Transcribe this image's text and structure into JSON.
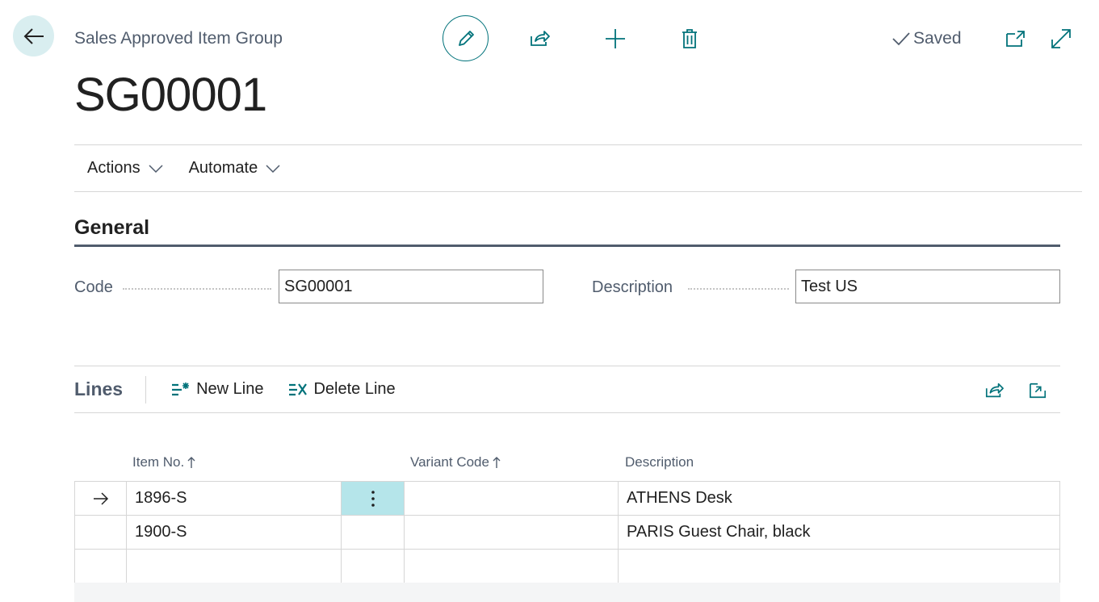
{
  "header": {
    "caption": "Sales Approved Item Group",
    "record_no": "SG00001",
    "status": "Saved"
  },
  "menubar": {
    "items": [
      {
        "label": "Actions"
      },
      {
        "label": "Automate"
      }
    ]
  },
  "general": {
    "title": "General",
    "code_label": "Code",
    "code_value": "SG00001",
    "description_label": "Description",
    "description_value": "Test US"
  },
  "lines": {
    "title": "Lines",
    "new_line_label": "New Line",
    "delete_line_label": "Delete Line",
    "columns": [
      "Item No.",
      "Variant Code",
      "Description"
    ],
    "rows": [
      {
        "item_no": "1896-S",
        "variant_code": "",
        "description": "ATHENS Desk"
      },
      {
        "item_no": "1900-S",
        "variant_code": "",
        "description": "PARIS Guest Chair, black"
      },
      {
        "item_no": "",
        "variant_code": "",
        "description": ""
      }
    ]
  },
  "colors": {
    "accent": "#00727a",
    "accent_light": "#d9eef0",
    "selected_cell": "#b5e5ea",
    "muted_text": "#505c6d"
  },
  "icons": {
    "back": "arrow-left-icon",
    "edit": "pencil-icon",
    "share": "share-icon",
    "new": "plus-icon",
    "delete": "trash-icon",
    "saved": "checkmark-icon",
    "open_new_window": "open-in-new-window-icon",
    "expand": "expand-icon"
  }
}
